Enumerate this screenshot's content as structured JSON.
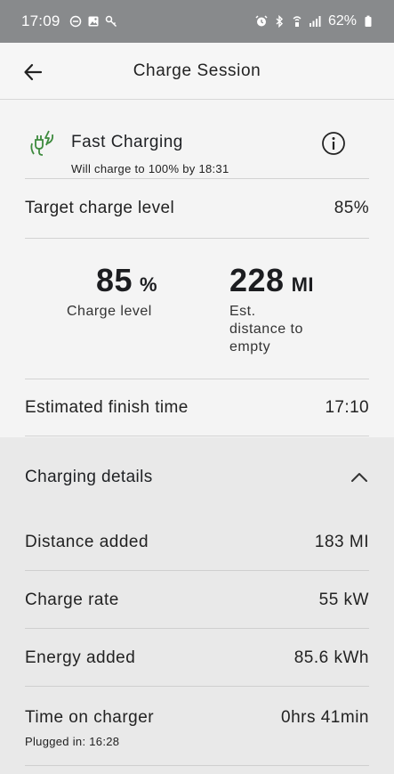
{
  "status_bar": {
    "time": "17:09",
    "battery": "62%",
    "left_icons": [
      "do-not-disturb-icon",
      "gallery-icon",
      "key-icon"
    ],
    "right_icons": [
      "alarm-icon",
      "bluetooth-icon",
      "wifi-calling-icon",
      "signal-icon",
      "battery-icon"
    ]
  },
  "header": {
    "title": "Charge Session"
  },
  "charging": {
    "type_label": "Fast Charging",
    "subtitle": "Will charge to 100% by 18:31",
    "accent_color": "#3d8a3d"
  },
  "target": {
    "label": "Target charge level",
    "value": "85%"
  },
  "stats": {
    "charge_level": {
      "value": "85",
      "unit": "%",
      "label": "Charge level"
    },
    "distance": {
      "value": "228",
      "unit": "MI",
      "label_lines": [
        "Est.",
        "distance to",
        "empty"
      ]
    }
  },
  "finish": {
    "label": "Estimated finish time",
    "value": "17:10"
  },
  "details": {
    "title": "Charging details",
    "rows": [
      {
        "label": "Distance added",
        "value": "183 MI"
      },
      {
        "label": "Charge rate",
        "value": "55 kW"
      },
      {
        "label": "Energy added",
        "value": "85.6 kWh"
      },
      {
        "label": "Time on charger",
        "value": "0hrs 41min",
        "sub": "Plugged in: 16:28"
      }
    ]
  }
}
